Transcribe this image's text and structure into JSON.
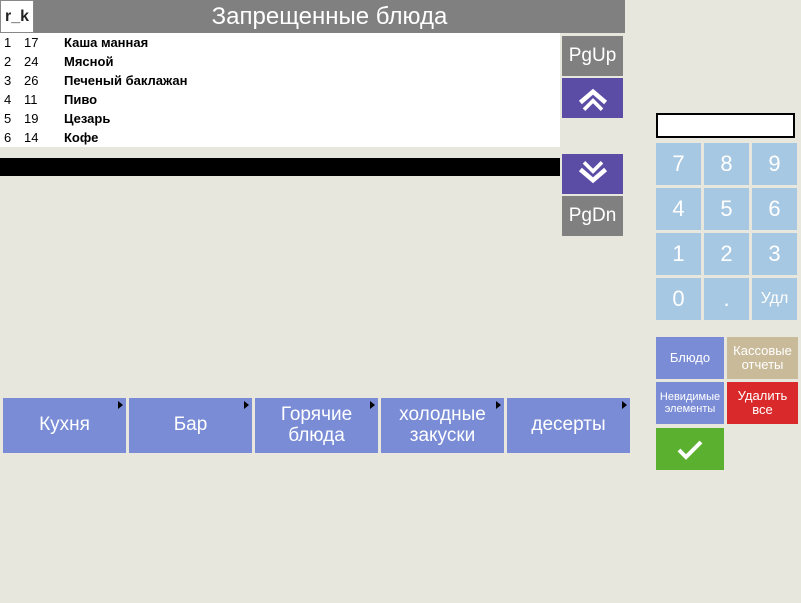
{
  "header": {
    "logo": "r_k",
    "title": "Запрещенные блюда"
  },
  "rows": [
    {
      "idx": "1",
      "code": "17",
      "name": "Каша манная"
    },
    {
      "idx": "2",
      "code": "24",
      "name": "Мясной"
    },
    {
      "idx": "3",
      "code": "26",
      "name": "Печеный баклажан"
    },
    {
      "idx": "4",
      "code": "11",
      "name": "Пиво"
    },
    {
      "idx": "5",
      "code": "19",
      "name": "Цезарь"
    },
    {
      "idx": "6",
      "code": "14",
      "name": "Кофе"
    }
  ],
  "nav": {
    "pgup": "PgUp",
    "pgdn": "PgDn"
  },
  "keypad": [
    "7",
    "8",
    "9",
    "4",
    "5",
    "6",
    "1",
    "2",
    "3",
    "0",
    ".",
    "Удл"
  ],
  "actions": {
    "dish": "Блюдо",
    "reports": "Кассовые отчеты",
    "hidden": "Невидимые элементы",
    "delete": "Удалить все"
  },
  "categories": [
    "Кухня",
    "Бар",
    "Горячие блюда",
    "холодные закуски",
    "десерты"
  ]
}
